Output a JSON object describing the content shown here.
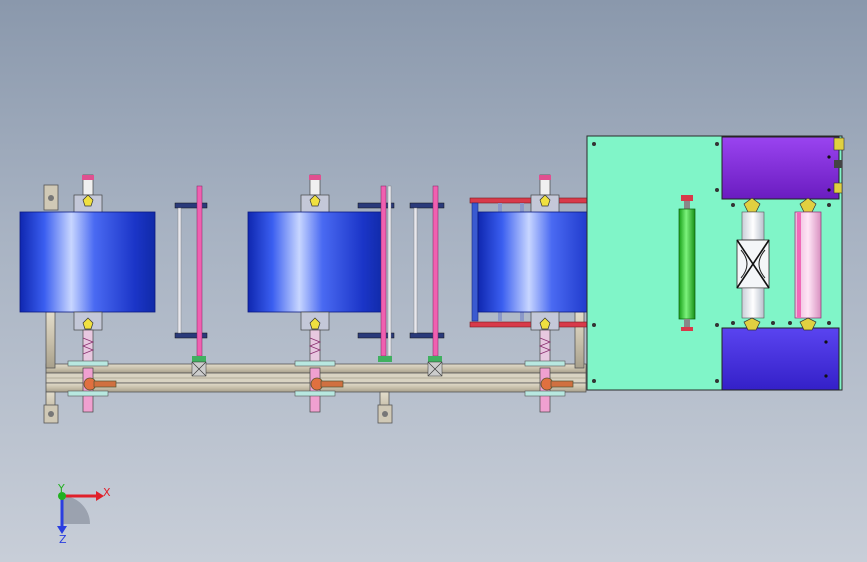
{
  "viewport": {
    "background_top": "#8a98ac",
    "background_bottom": "#c8ced8"
  },
  "triad": {
    "x_label": "X",
    "y_label": "Y",
    "z_label": "Z",
    "x_color": "#e0202a",
    "y_color": "#22b020",
    "z_color": "#2a3ee0"
  },
  "colors": {
    "roll_blue": "#1c3ad8",
    "plate_green": "#7ff5c8",
    "box_purple": "#8a2ae0",
    "box_indigo": "#4a32e0",
    "rail": "#cfc7b3",
    "pink_rod": "#e050a0",
    "red_bar": "#d83a4a",
    "green_roller": "#30d030"
  }
}
